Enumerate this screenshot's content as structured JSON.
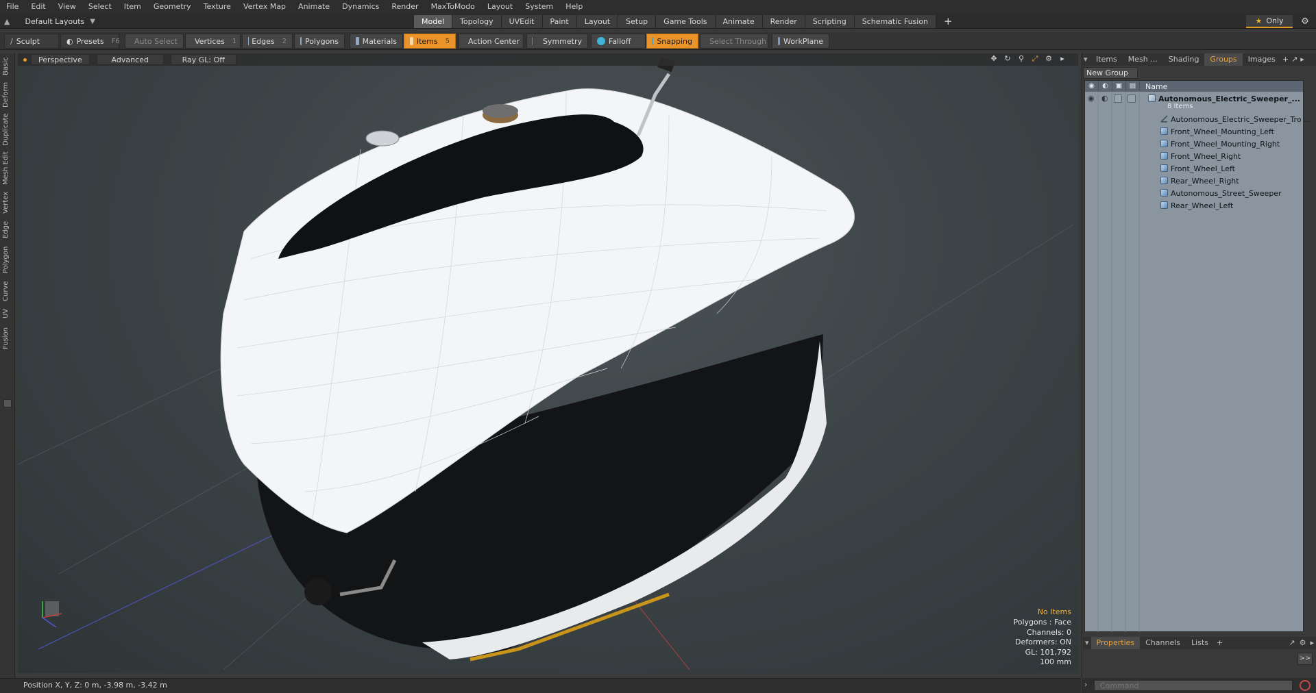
{
  "menu": [
    "File",
    "Edit",
    "View",
    "Select",
    "Item",
    "Geometry",
    "Texture",
    "Vertex Map",
    "Animate",
    "Dynamics",
    "Render",
    "MaxToModo",
    "Layout",
    "System",
    "Help"
  ],
  "layout": {
    "dropdown": "Default Layouts",
    "only_label": "Only"
  },
  "tabs": [
    "Model",
    "Topology",
    "UVEdit",
    "Paint",
    "Layout",
    "Setup",
    "Game Tools",
    "Animate",
    "Render",
    "Scripting",
    "Schematic Fusion"
  ],
  "active_tab": "Model",
  "toolbar": {
    "sculpt": "Sculpt",
    "presets": "Presets",
    "presets_key": "F6",
    "auto_select": "Auto Select",
    "vertices": "Vertices",
    "vertices_count": "1",
    "edges": "Edges",
    "edges_count": "2",
    "polygons": "Polygons",
    "materials": "Materials",
    "items": "Items",
    "items_count": "5",
    "action_center": "Action Center",
    "symmetry": "Symmetry",
    "falloff": "Falloff",
    "snapping": "Snapping",
    "select_through": "Select Through",
    "workplane": "WorkPlane"
  },
  "left_tabs": [
    "Basic",
    "Deform",
    "Duplicate",
    "Mesh Edit",
    "Vertex",
    "Edge",
    "Polygon",
    "Curve",
    "UV",
    "Fusion"
  ],
  "viewport": {
    "view": "Perspective",
    "shading": "Advanced",
    "raygl": "Ray GL: Off",
    "info": {
      "no_items": "No Items",
      "polygons": "Polygons : Face",
      "channels": "Channels: 0",
      "deformers": "Deformers: ON",
      "gl": "GL: 101,792",
      "unit": "100 mm"
    }
  },
  "status": "Position X, Y, Z:  0 m, -3.98 m, -3.42 m",
  "right_panel": {
    "tabs": [
      "Items",
      "Mesh ...",
      "Shading",
      "Groups",
      "Images"
    ],
    "active_tab": "Groups",
    "new_group": "New Group",
    "name_col": "Name",
    "group_name": "Autonomous_Electric_Sweeper_...",
    "group_count": "8 Items",
    "items": [
      {
        "label": "Autonomous_Electric_Sweeper_Tro ...",
        "icon": "locator-icon"
      },
      {
        "label": "Front_Wheel_Mounting_Left",
        "icon": "mesh-icon"
      },
      {
        "label": "Front_Wheel_Mounting_Right",
        "icon": "mesh-icon"
      },
      {
        "label": "Front_Wheel_Right",
        "icon": "mesh-icon"
      },
      {
        "label": "Front_Wheel_Left",
        "icon": "mesh-icon"
      },
      {
        "label": "Rear_Wheel_Right",
        "icon": "mesh-icon"
      },
      {
        "label": "Autonomous_Street_Sweeper",
        "icon": "mesh-icon"
      },
      {
        "label": "Rear_Wheel_Left",
        "icon": "mesh-icon"
      }
    ]
  },
  "bottom_panel": {
    "tabs": [
      "Properties",
      "Channels",
      "Lists"
    ],
    "active_tab": "Properties",
    "expand": ">>"
  },
  "command": {
    "placeholder": "Command"
  },
  "colors": {
    "accent": "#e9932a",
    "list_bg": "#8a95a0"
  }
}
